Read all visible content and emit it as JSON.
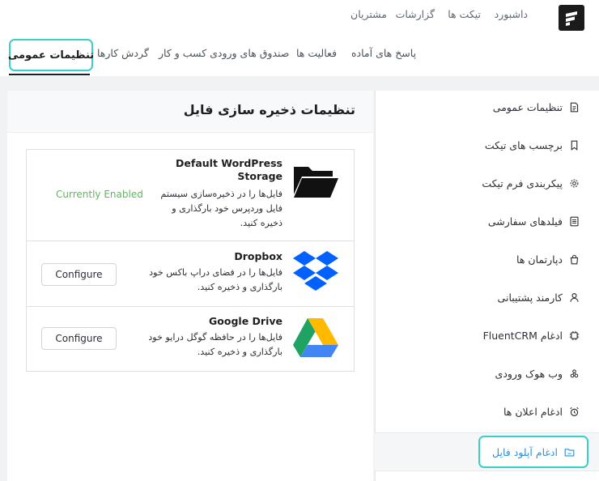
{
  "header": {
    "nav": [
      "داشبورد",
      "تیکت ها",
      "گزارشات",
      "مشتریان"
    ]
  },
  "tabs": {
    "active": "تنظیمات عمومی",
    "items": [
      "گردش کارها",
      "صندوق های ورودی کسب و کار",
      "فعالیت ها",
      "پاسخ های آماده"
    ]
  },
  "sidebar": {
    "items": [
      {
        "label": "تنظیمات عمومی",
        "icon": "document-icon"
      },
      {
        "label": "برچسب های تیکت",
        "icon": "bookmark-icon"
      },
      {
        "label": "پیکربندی فرم تیکت",
        "icon": "gear-icon"
      },
      {
        "label": "فیلدهای سفارشی",
        "icon": "list-icon"
      },
      {
        "label": "دپارتمان ها",
        "icon": "bag-icon"
      },
      {
        "label": "کارمند پشتیبانی",
        "icon": "user-icon"
      },
      {
        "label": "ادغام FluentCRM",
        "icon": "chip-icon"
      },
      {
        "label": "وب هوک ورودی",
        "icon": "webhook-icon"
      },
      {
        "label": "ادغام اعلان ها",
        "icon": "alarm-icon"
      }
    ],
    "active": {
      "label": "ادغام آپلود فایل",
      "icon": "folder-icon"
    }
  },
  "main": {
    "title": "تنظیمات ذخیره سازی فایل",
    "storages": [
      {
        "name": "Default WordPress Storage",
        "name_lines": [
          "Default WordPress",
          "Storage"
        ],
        "description_lines": [
          "فایل‌ها را در ذخیره‌سازی سیستم",
          "فایل وردپرس خود بارگذاری و",
          "ذخیره کنید."
        ],
        "status": "Currently Enabled",
        "icon": "folder-open-icon"
      },
      {
        "name": "Dropbox",
        "description_lines": [
          "فایل‌ها را در فضای دراپ باکس خود",
          "بارگذاری و ذخیره کنید."
        ],
        "button": "Configure",
        "icon": "dropbox-icon",
        "color": "#0061fe"
      },
      {
        "name": "Google Drive",
        "description_lines": [
          "فایل‌ها را در حافظه گوگل درایو خود",
          "بارگذاری و ذخیره کنید."
        ],
        "button": "Configure",
        "icon": "google-drive-icon",
        "colors": [
          "#1ea362",
          "#ffba00",
          "#4285f4"
        ]
      }
    ]
  },
  "colors": {
    "highlight": "#39d0c8",
    "link": "#2f8fd6",
    "enabled": "#5cb85c"
  }
}
